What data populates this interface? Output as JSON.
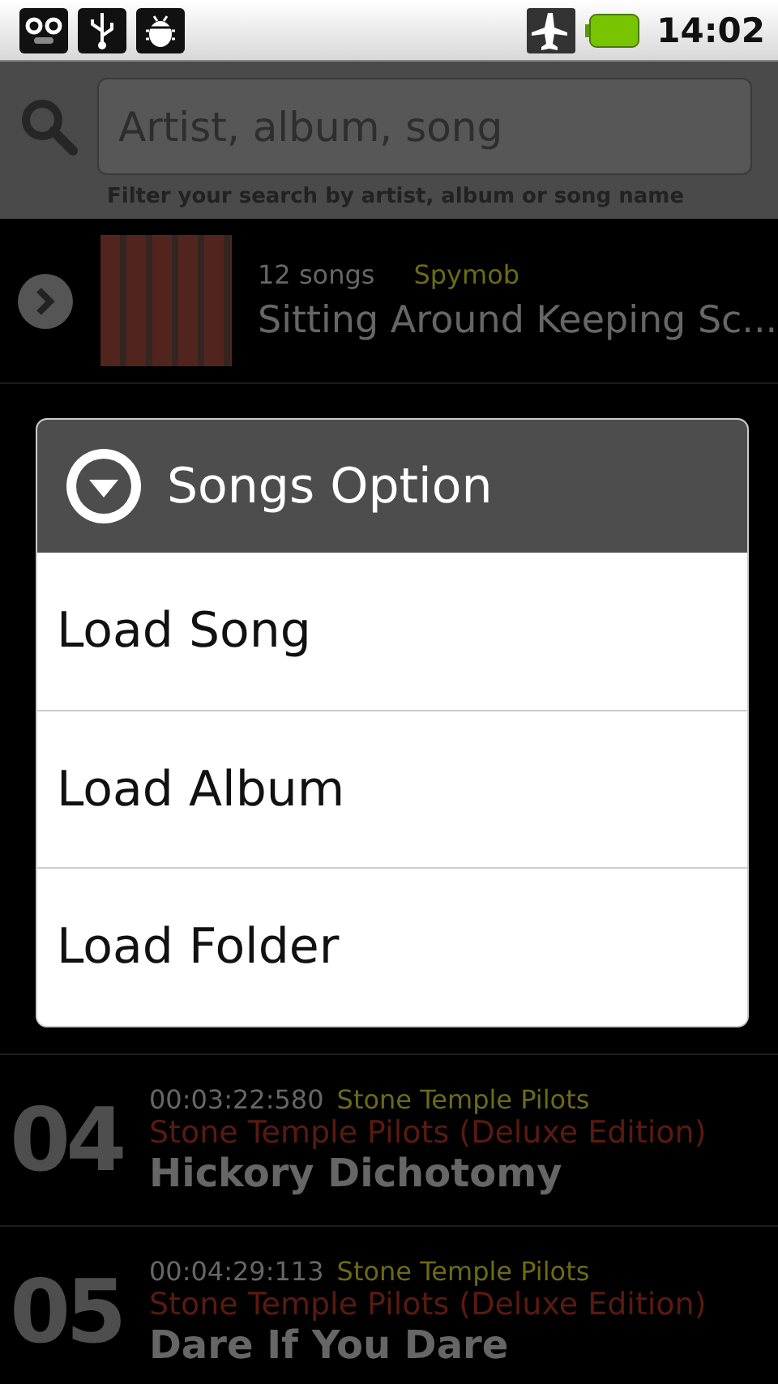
{
  "status_bar": {
    "time": "14:02"
  },
  "search": {
    "placeholder": "Artist, album, song",
    "hint": "Filter your search by artist, album or song name"
  },
  "albums": [
    {
      "count": "12 songs",
      "artist": "Spymob",
      "title": "Sitting Around Keeping Sc..."
    }
  ],
  "tracks": [
    {
      "number": "04",
      "duration": "00:03:22:580",
      "artist": "Stone Temple Pilots",
      "album": "Stone Temple Pilots (Deluxe Edition)",
      "title": "Hickory Dichotomy"
    },
    {
      "number": "05",
      "duration": "00:04:29:113",
      "artist": "Stone Temple Pilots",
      "album": "Stone Temple Pilots (Deluxe Edition)",
      "title": "Dare If You Dare"
    }
  ],
  "dialog": {
    "title": "Songs Option",
    "options": [
      "Load Song",
      "Load Album",
      "Load Folder"
    ]
  }
}
